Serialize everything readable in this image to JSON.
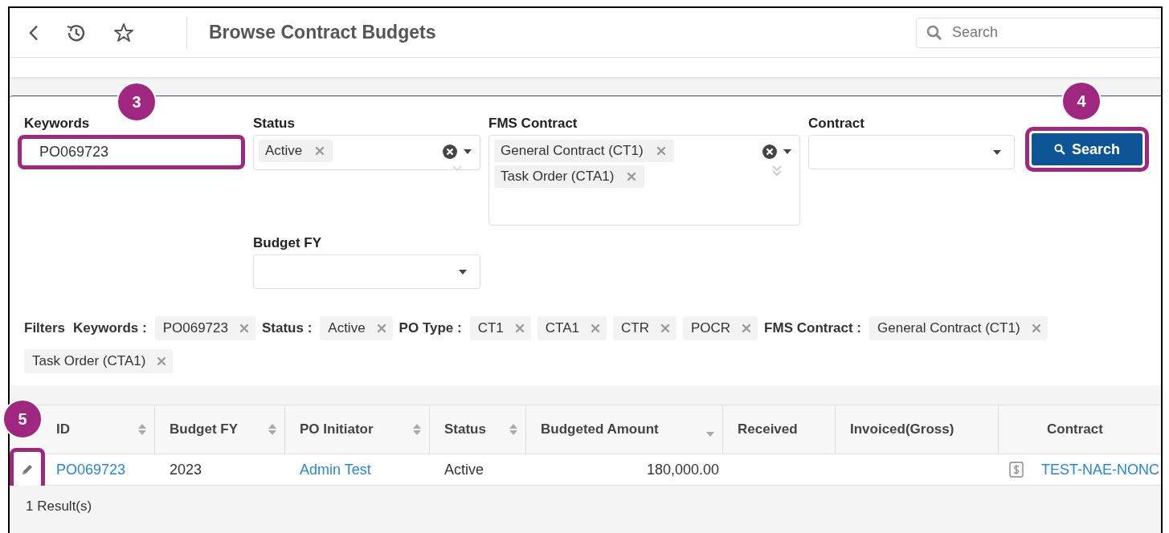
{
  "header": {
    "title": "Browse Contract Budgets",
    "search_placeholder": "Search"
  },
  "form": {
    "keywords": {
      "label": "Keywords",
      "value": "PO069723",
      "callout": "3"
    },
    "status": {
      "label": "Status",
      "tags": [
        "Active"
      ]
    },
    "fms_contract": {
      "label": "FMS Contract",
      "tags": [
        "General Contract (CT1)",
        "Task Order (CTA1)"
      ]
    },
    "contract": {
      "label": "Contract"
    },
    "search_button": {
      "label": "Search",
      "callout": "4"
    },
    "budget_fy": {
      "label": "Budget FY"
    }
  },
  "active_filters": {
    "label": "Filters",
    "groups": [
      {
        "name": "Keywords :",
        "chips": [
          "PO069723"
        ]
      },
      {
        "name": "Status :",
        "chips": [
          "Active"
        ]
      },
      {
        "name": "PO Type :",
        "chips": [
          "CT1",
          "CTA1",
          "CTR",
          "POCR"
        ]
      },
      {
        "name": "FMS Contract :",
        "chips": [
          "General Contract (CT1)",
          "Task Order (CTA1)"
        ]
      }
    ]
  },
  "table": {
    "edit_callout": "5",
    "columns": [
      {
        "label": "ID",
        "sortable": true
      },
      {
        "label": "Budget FY",
        "sortable": true
      },
      {
        "label": "PO Initiator",
        "sortable": true
      },
      {
        "label": "Status",
        "sortable": true
      },
      {
        "label": "Budgeted Amount",
        "sorted": true
      },
      {
        "label": "Received",
        "sortable": false
      },
      {
        "label": "Invoiced(Gross)",
        "sortable": false
      },
      {
        "label": "Contract",
        "sortable": false
      }
    ],
    "rows": [
      {
        "cells": [
          {
            "text": "PO069723",
            "kind": "link"
          },
          {
            "text": "2023",
            "kind": "text"
          },
          {
            "text": "Admin Test",
            "kind": "link"
          },
          {
            "text": "Active",
            "kind": "text"
          },
          {
            "text": "180,000.00",
            "kind": "amount"
          },
          {
            "kind": "empty"
          },
          {
            "kind": "empty"
          },
          {
            "text": "TEST-NAE-NONC",
            "kind": "contract-link"
          }
        ]
      }
    ],
    "result_count": "1 Result(s)"
  }
}
